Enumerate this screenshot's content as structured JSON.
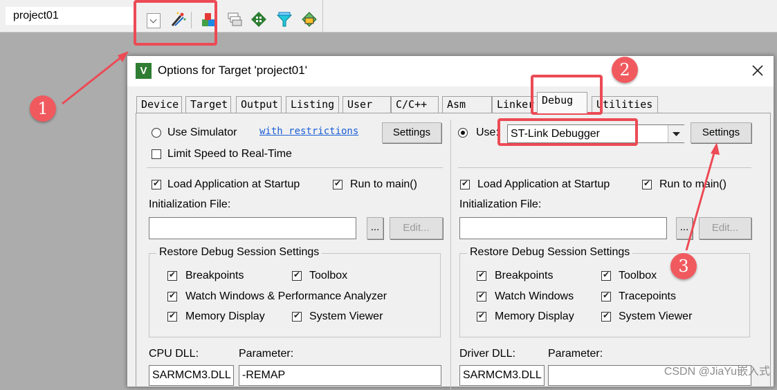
{
  "toolbar": {
    "target_name": "project01",
    "icons": [
      "dropdown-arrow",
      "options-wand-icon",
      "manage-components-icon",
      "select-packs-icon",
      "pack-installer-icon",
      "update-icon",
      "map-icon"
    ]
  },
  "dialog": {
    "title": "Options for Target 'project01'",
    "tabs": [
      "Device",
      "Target",
      "Output",
      "Listing",
      "User",
      "C/C++",
      "Asm",
      "Linker",
      "Debug",
      "Utilities"
    ],
    "active_tab": "Debug",
    "left": {
      "use_simulator": "Use Simulator",
      "with_restrictions": "with restrictions",
      "settings": "Settings",
      "limit_speed": "Limit Speed to Real-Time",
      "load_app": "Load Application at Startup",
      "run_to_main": "Run to main()",
      "init_file": "Initialization File:",
      "browse": "...",
      "edit": "Edit...",
      "restore_title": "Restore Debug Session Settings",
      "breakpoints": "Breakpoints",
      "toolbox": "Toolbox",
      "watch_windows": "Watch Windows & Performance Analyzer",
      "memory_display": "Memory Display",
      "system_viewer": "System Viewer",
      "cpu_dll_label": "CPU DLL:",
      "parameter_label": "Parameter:",
      "cpu_dll_value": "SARMCM3.DLL",
      "parameter_value": "-REMAP"
    },
    "right": {
      "use_label": "Use:",
      "debugger": "ST-Link Debugger",
      "settings": "Settings",
      "load_app": "Load Application at Startup",
      "run_to_main": "Run to main()",
      "init_file": "Initialization File:",
      "browse": "...",
      "edit": "Edit...",
      "restore_title": "Restore Debug Session Settings",
      "breakpoints": "Breakpoints",
      "toolbox": "Toolbox",
      "watch_windows": "Watch Windows",
      "tracepoints": "Tracepoints",
      "memory_display": "Memory Display",
      "system_viewer": "System Viewer",
      "driver_dll_label": "Driver DLL:",
      "parameter_label": "Parameter:",
      "driver_dll_value": "SARMCM3.DLL"
    }
  },
  "annotations": {
    "badge1": "1",
    "badge2": "2",
    "badge3": "3",
    "color": "#ec4a55"
  },
  "watermark": "CSDN @JiaYu嵌入式"
}
